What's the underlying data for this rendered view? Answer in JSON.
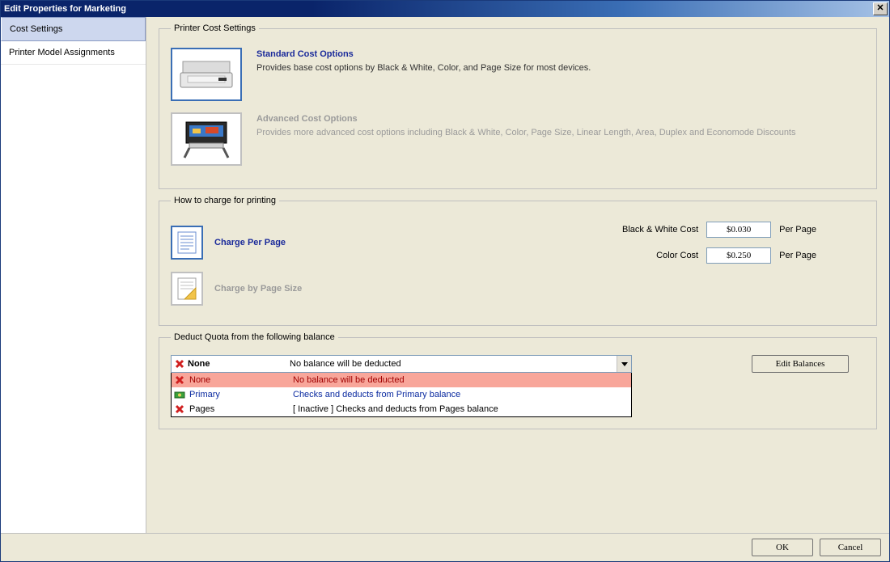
{
  "titlebar": {
    "title": "Edit Properties for Marketing"
  },
  "sidebar": {
    "items": [
      {
        "label": "Cost Settings"
      },
      {
        "label": "Printer Model Assignments"
      }
    ]
  },
  "printer_cost_settings": {
    "legend": "Printer Cost Settings",
    "standard": {
      "title": "Standard Cost Options",
      "desc": "Provides base cost options by Black & White, Color, and Page Size for most devices."
    },
    "advanced": {
      "title": "Advanced Cost Options",
      "desc": "Provides more advanced cost options including Black & White, Color, Page Size, Linear Length, Area, Duplex and Economode Discounts"
    }
  },
  "charge": {
    "legend": "How to charge for printing",
    "per_page_label": "Charge Per Page",
    "by_size_label": "Charge by Page Size",
    "bw_label": "Black & White Cost",
    "color_label": "Color Cost",
    "bw_value": "$0.030",
    "color_value": "$0.250",
    "suffix": "Per Page"
  },
  "quota": {
    "legend": "Deduct Quota from the following balance",
    "selected": {
      "name": "None",
      "desc": "No balance will be deducted"
    },
    "options": [
      {
        "name": "None",
        "desc": "No balance will be deducted"
      },
      {
        "name": "Primary",
        "desc": "Checks and deducts from Primary balance"
      },
      {
        "name": "Pages",
        "desc": "[ Inactive ] Checks and deducts from Pages balance"
      }
    ],
    "edit_balances_label": "Edit Balances"
  },
  "footer": {
    "ok": "OK",
    "cancel": "Cancel"
  }
}
